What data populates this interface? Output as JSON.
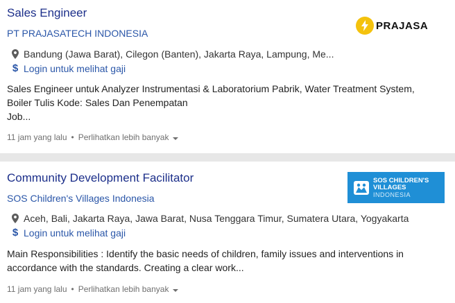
{
  "jobs": [
    {
      "title": "Sales Engineer",
      "company": "PT PRAJASATECH INDONESIA",
      "location": "Bandung (Jawa Barat), Cilegon (Banten), Jakarta Raya, Lampung, Me...",
      "salary": "Login untuk melihat gaji",
      "snippet_lines": [
        "Sales Engineer untuk Analyzer Instrumentasi & Laboratorium Pabrik, Water Treatment System,",
        "Boiler Tulis Kode: Sales Dan Penempatan",
        "Job..."
      ],
      "posted": "11 jam yang lalu",
      "more": "Perlihatkan lebih banyak",
      "logo": {
        "text": "PRAJASA",
        "icon": "lightning-bolt-icon",
        "color": "#f4c20d"
      }
    },
    {
      "title": "Community Development Facilitator",
      "company": "SOS Children's Villages Indonesia",
      "location": "Aceh, Bali, Jakarta Raya, Jawa Barat, Nusa Tenggara Timur, Sumatera Utara, Yogyakarta",
      "salary": "Login untuk melihat gaji",
      "snippet_lines": [
        "Main Responsibilities : Identify the basic needs of children, family issues and interventions in",
        "accordance with the standards. Creating a clear work..."
      ],
      "posted": "11 jam yang lalu",
      "more": "Perlihatkan lebih banyak",
      "logo": {
        "line1": "SOS CHILDREN'S",
        "line2": "VILLAGES",
        "line3": "INDONESIA",
        "icon": "sos-children-icon",
        "color": "#1f8fd6"
      }
    }
  ],
  "colors": {
    "title": "#1c2f8a",
    "link": "#2a56a8",
    "separator": "#e7e7e7"
  }
}
